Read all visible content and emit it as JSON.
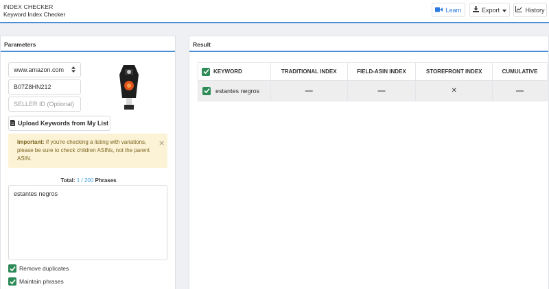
{
  "header": {
    "app_title": "INDEX CHECKER",
    "app_subtitle": "Keyword Index Checker",
    "buttons": {
      "learn": "Learn",
      "export": "Export",
      "history": "History"
    }
  },
  "parameters": {
    "title": "Parameters",
    "marketplace": "www.amazon.com",
    "asin": "B07Z8HN212",
    "seller_placeholder": "SELLER ID (Optional)",
    "upload_label": "Upload Keywords from My List",
    "alert": {
      "strong": "Important:",
      "text": " If you're checking a listing with variations, please be sure to check children ASINs, not the parent ASIN."
    },
    "total": {
      "label": "Total:",
      "count": "1 / 200",
      "suffix": "Phrases"
    },
    "keywords_text": "estantes negros",
    "options": {
      "remove_duplicates": "Remove duplicates",
      "maintain_phrases": "Maintain phrases"
    }
  },
  "result": {
    "title": "Result",
    "columns": [
      "KEYWORD",
      "TRADITIONAL INDEX",
      "FIELD-ASIN INDEX",
      "STOREFRONT INDEX",
      "CUMULATIVE"
    ],
    "rows": [
      {
        "keyword": "estantes negros",
        "traditional": "—",
        "field_asin": "—",
        "storefront": "✕",
        "cumulative": "—"
      }
    ]
  },
  "colors": {
    "accent": "#4a90d9",
    "check_green": "#2e8b57",
    "alert_bg": "#fcf3d6",
    "alert_text": "#7d6622",
    "link_blue": "#3b9dd6"
  }
}
